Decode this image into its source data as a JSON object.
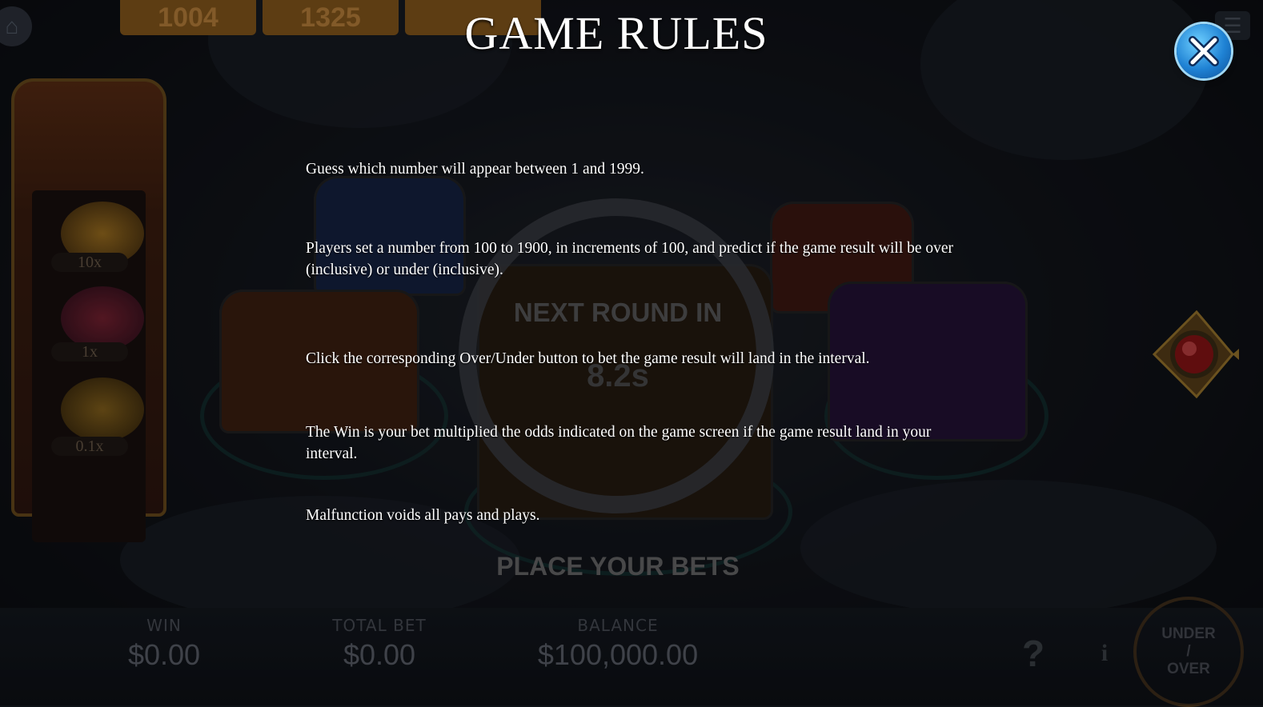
{
  "overlay": {
    "title": "GAME RULES",
    "close_icon": "close-icon",
    "rules": [
      "Guess which number will appear between 1 and 1999.",
      "Players set a number from 100 to 1900, in increments of 100, and predict if the game result will be over (inclusive) or under (inclusive).",
      "Click the corresponding Over/Under button to bet the game result will land in the interval.",
      "The Win is your bet multiplied the odds indicated on the game screen if the game result land in your interval.",
      "Malfunction voids all pays and plays."
    ]
  },
  "background": {
    "history": [
      "1004",
      "1325"
    ],
    "odds": [
      {
        "label": "10x",
        "icon": "crown-icon"
      },
      {
        "label": "1x",
        "icon": "gems-icon"
      },
      {
        "label": "0.1x",
        "icon": "coins-icon"
      }
    ],
    "timer_title": "NEXT ROUND IN",
    "timer_value": "8.2s",
    "place_bets": "PLACE YOUR BETS",
    "win_label": "WIN",
    "win_value": "$0.00",
    "total_bet_label": "TOTAL BET",
    "total_bet_value": "$0.00",
    "balance_label": "BALANCE",
    "balance_value": "$100,000.00",
    "help_label": "?",
    "info_label": "i",
    "mode_top": "UNDER",
    "mode_sep": "/",
    "mode_bottom": "OVER"
  },
  "colors": {
    "close_button": "#1f82d4",
    "title_text": "#ffffff",
    "history_chip": "#8a5a18"
  }
}
